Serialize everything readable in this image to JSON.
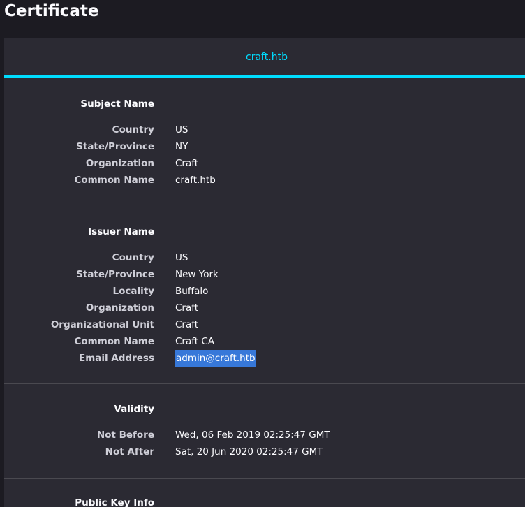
{
  "page": {
    "title": "Certificate"
  },
  "tab": {
    "label": "craft.htb"
  },
  "subject": {
    "title": "Subject Name",
    "rows": [
      {
        "label": "Country",
        "value": "US"
      },
      {
        "label": "State/Province",
        "value": "NY"
      },
      {
        "label": "Organization",
        "value": "Craft"
      },
      {
        "label": "Common Name",
        "value": "craft.htb"
      }
    ]
  },
  "issuer": {
    "title": "Issuer Name",
    "rows": [
      {
        "label": "Country",
        "value": "US"
      },
      {
        "label": "State/Province",
        "value": "New York"
      },
      {
        "label": "Locality",
        "value": "Buffalo"
      },
      {
        "label": "Organization",
        "value": "Craft"
      },
      {
        "label": "Organizational Unit",
        "value": "Craft"
      },
      {
        "label": "Common Name",
        "value": "Craft CA"
      },
      {
        "label": "Email Address",
        "value": "admin@craft.htb"
      }
    ]
  },
  "validity": {
    "title": "Validity",
    "rows": [
      {
        "label": "Not Before",
        "value": "Wed, 06 Feb 2019 02:25:47 GMT"
      },
      {
        "label": "Not After",
        "value": "Sat, 20 Jun 2020 02:25:47 GMT"
      }
    ]
  },
  "public_key": {
    "title": "Public Key Info"
  },
  "colors": {
    "accent": "#00ddff",
    "selection": "#3778d9",
    "panel": "#2b2a33",
    "background": "#1c1b22"
  }
}
